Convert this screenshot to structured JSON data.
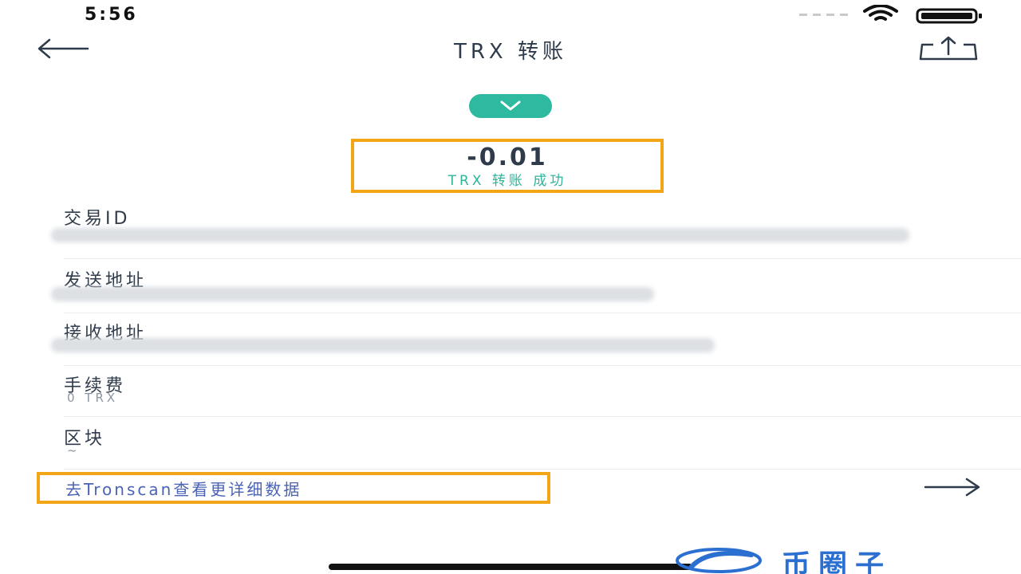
{
  "status_bar": {
    "time": "5:56",
    "icons": [
      "signal-dots-icon",
      "wifi-icon",
      "battery-icon"
    ]
  },
  "nav": {
    "title": "TRX 转账",
    "back_icon": "back-arrow-icon",
    "share_icon": "share-icon"
  },
  "transaction": {
    "status_icon": "checkmark-chevron-icon",
    "amount": "-0.01",
    "status_text": "TRX 转账 成功"
  },
  "details": {
    "tx_id_label": "交易ID",
    "sender_label": "发送地址",
    "receiver_label": "接收地址",
    "fee_label": "手续费",
    "fee_value": "0 TRX",
    "block_label": "区块",
    "block_value": "~"
  },
  "link": {
    "text": "去Tronscan查看更详细数据",
    "arrow_icon": "right-arrow-icon"
  },
  "watermark": {
    "text": "币圈子"
  },
  "colors": {
    "accent_green": "#2dbaa0",
    "highlight_orange": "#f2a516",
    "link_blue": "#4a63b5",
    "text_dark": "#2f3b4a",
    "text_gray": "#8b95a1",
    "watermark_blue": "#2b6fd0"
  }
}
